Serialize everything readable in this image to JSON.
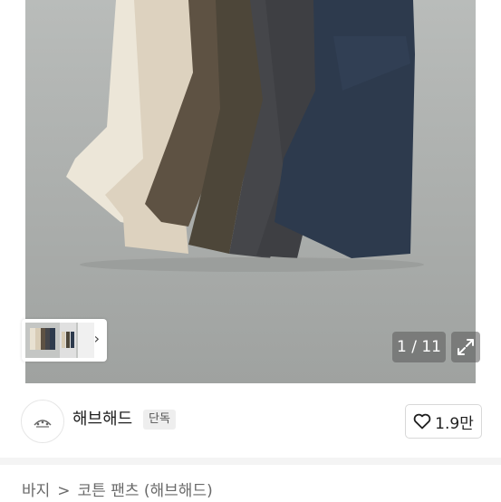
{
  "gallery": {
    "counter": "1 / 11",
    "expand_icon": "expand-icon",
    "thumbnail_next_icon": "chevron-right-icon"
  },
  "store": {
    "name": "해브해드",
    "badge": "단독",
    "like_count": "1.9만",
    "like_icon": "heart-icon"
  },
  "breadcrumb": {
    "category": "바지",
    "separator": ">",
    "product": "코튼 팬츠 (해브해드)"
  }
}
